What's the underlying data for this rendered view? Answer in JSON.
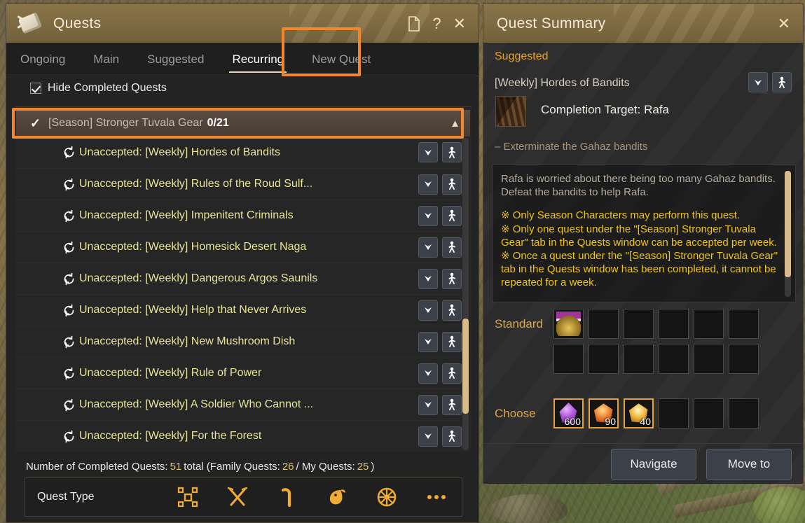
{
  "quests_window": {
    "title": "Quests",
    "icons": {
      "scroll": "scroll-icon",
      "note": "note-icon",
      "help": "?",
      "close": "✕"
    },
    "tabs": [
      {
        "label": "Ongoing",
        "active": false
      },
      {
        "label": "Main",
        "active": false
      },
      {
        "label": "Suggested",
        "active": false
      },
      {
        "label": "Recurring",
        "active": true
      },
      {
        "label": "New Quest",
        "active": false
      }
    ],
    "hide_completed": {
      "label": "Hide Completed Quests",
      "checked": true
    },
    "group": {
      "title": "[Season] Stronger Tuvala Gear",
      "count": "0/21",
      "expanded": true,
      "collapse_arrow": "▲"
    },
    "quest_rows": [
      {
        "label": "Unaccepted: [Weekly] Hordes of Bandits"
      },
      {
        "label": "Unaccepted: [Weekly] Rules of the Roud Sulf..."
      },
      {
        "label": "Unaccepted: [Weekly] Impenitent Criminals"
      },
      {
        "label": "Unaccepted: [Weekly] Homesick Desert Naga"
      },
      {
        "label": "Unaccepted: [Weekly] Dangerous Argos Saunils"
      },
      {
        "label": "Unaccepted: [Weekly] Help that Never Arrives"
      },
      {
        "label": "Unaccepted: [Weekly] New Mushroom Dish"
      },
      {
        "label": "Unaccepted: [Weekly] Rule of Power"
      },
      {
        "label": "Unaccepted: [Weekly] A Soldier Who Cannot ..."
      },
      {
        "label": "Unaccepted: [Weekly] For the Forest"
      }
    ],
    "completed_summary": {
      "prefix": "Number of Completed Quests:",
      "total": "51",
      "mid": "total (Family Quests:",
      "family": "26",
      "sep": "/ My Quests:",
      "mine": "25",
      "suffix": ")"
    },
    "quest_type_bar": {
      "label": "Quest Type",
      "icons": [
        "crafting-icon",
        "combat-icon",
        "hoe-icon",
        "fish-icon",
        "wheel-icon",
        "more-icon"
      ]
    }
  },
  "summary_window": {
    "title": "Quest Summary",
    "close": "✕",
    "category": "Suggested",
    "quest_name": "[Weekly] Hordes of Bandits",
    "completion_target": "Completion Target: Rafa",
    "objective": "– Exterminate the Gahaz bandits",
    "description_plain": "Rafa is worried about there being too many Gahaz bandits. Defeat the bandits to help Rafa.",
    "description_notes": "※ Only Season Characters may perform this quest.\n※ Only one quest under the \"[Season] Stronger Tuvala Gear\" tab in the Quests window can be accepted per week.\n※ Once a quest under the \"[Season] Stronger Tuvala Gear\" tab in the Quests window has been completed, it cannot be repeated for a week.",
    "rewards": {
      "standard_label": "Standard",
      "standard_rows": [
        [
          {
            "icon": "medal-icon",
            "qty": ""
          },
          {
            "icon": "",
            "qty": ""
          },
          {
            "icon": "",
            "qty": ""
          },
          {
            "icon": "",
            "qty": ""
          },
          {
            "icon": "",
            "qty": ""
          },
          {
            "icon": "",
            "qty": ""
          }
        ],
        [
          {
            "icon": "",
            "qty": ""
          },
          {
            "icon": "",
            "qty": ""
          },
          {
            "icon": "",
            "qty": ""
          },
          {
            "icon": "",
            "qty": ""
          },
          {
            "icon": "",
            "qty": ""
          },
          {
            "icon": "",
            "qty": ""
          }
        ]
      ],
      "choose_label": "Choose",
      "choose_row": [
        {
          "icon": "shard-purple-icon",
          "qty": "600",
          "selected": true
        },
        {
          "icon": "shard-red-icon",
          "qty": "90",
          "selected": true
        },
        {
          "icon": "shard-gold-icon",
          "qty": "40",
          "selected": true
        },
        {
          "icon": "",
          "qty": "",
          "selected": false
        },
        {
          "icon": "",
          "qty": "",
          "selected": false
        },
        {
          "icon": "",
          "qty": "",
          "selected": false
        }
      ]
    },
    "buttons": {
      "navigate": "Navigate",
      "move_to": "Move to"
    }
  },
  "colors": {
    "accent_orange": "#f2862c",
    "title_bar": "#7d6a42",
    "quest_yellow": "#e8e49a",
    "note_yellow": "#f0c419",
    "category_gold": "#e7a62f",
    "scrollbar": "#d8bb8a"
  }
}
